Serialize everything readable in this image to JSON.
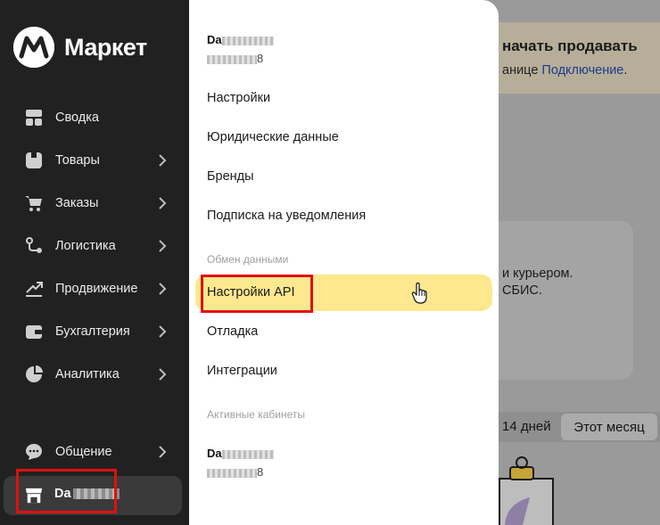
{
  "sidebar": {
    "logo_text": "Маркет",
    "items": [
      {
        "label": "Сводка",
        "icon": "dashboard-icon",
        "chevron": false
      },
      {
        "label": "Товары",
        "icon": "products-icon",
        "chevron": true
      },
      {
        "label": "Заказы",
        "icon": "cart-icon",
        "chevron": true
      },
      {
        "label": "Логистика",
        "icon": "route-icon",
        "chevron": true
      },
      {
        "label": "Продвижение",
        "icon": "trend-icon",
        "chevron": true
      },
      {
        "label": "Бухгалтерия",
        "icon": "wallet-icon",
        "chevron": true
      },
      {
        "label": "Аналитика",
        "icon": "pie-icon",
        "chevron": true
      },
      {
        "label": "Общение",
        "icon": "chat-icon",
        "chevron": true
      }
    ],
    "account_label": "Da"
  },
  "background": {
    "banner_title": "начать продавать",
    "banner_text": "анице",
    "banner_link": "Подключение",
    "banner_end": ".",
    "card_line1": "и курьером.",
    "card_line2": "СБИС.",
    "period_14": "14 дней",
    "period_month": "Этот месяц"
  },
  "panel": {
    "account_top": {
      "name": "Da",
      "id_end": "8"
    },
    "items_top": [
      "Настройки",
      "Юридические данные",
      "Бренды",
      "Подписка на уведомления"
    ],
    "section_exchange": "Обмен данными",
    "items_exchange": [
      "Настройки API",
      "Отладка",
      "Интеграции"
    ],
    "section_active": "Активные кабинеты",
    "account_bottom": {
      "name": "Da",
      "id_end": "8"
    }
  },
  "colors": {
    "sidebar_bg": "#212121",
    "highlight": "#fde88f",
    "annotation_red": "#e01010",
    "link_blue": "#1d3a8a"
  }
}
